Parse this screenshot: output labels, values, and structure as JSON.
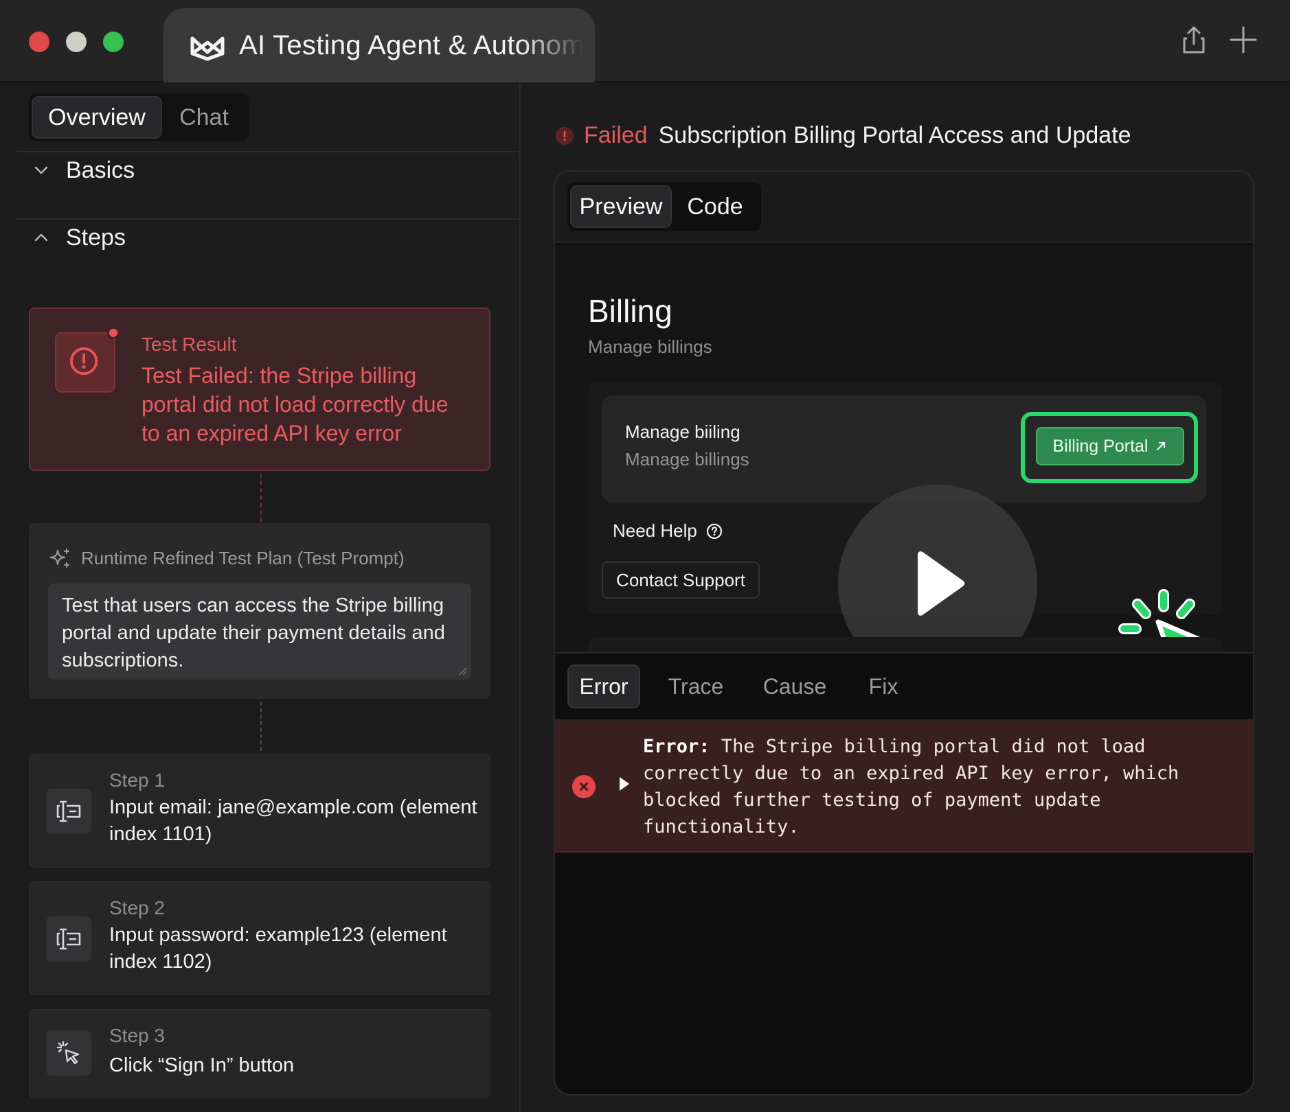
{
  "window": {
    "title": "AI Testing Agent & Autonomous Testing",
    "buttons": {
      "close": "close-dot",
      "minimize": "minimize-dot",
      "maximize": "maximize-dot"
    },
    "actions": [
      "share-icon",
      "plus-icon"
    ]
  },
  "left": {
    "tabs": [
      {
        "label": "Overview",
        "active": true
      },
      {
        "label": "Chat",
        "active": false
      }
    ],
    "sections": {
      "basics": "Basics",
      "steps": "Steps"
    },
    "result": {
      "label": "Test Result",
      "text": "Test Failed: the Stripe billing portal did not load correctly due to an expired API key error"
    },
    "plan": {
      "label": "Runtime Refined Test Plan (Test Prompt)",
      "text": "Test that users can access the Stripe billing portal and update their payment details and subscriptions."
    },
    "steps": [
      {
        "number": "Step 1",
        "text": "Input email: jane@example.com (element index 1101)",
        "icon": "text-input-icon"
      },
      {
        "number": "Step 2",
        "text": "Input password: example123 (element index 1102)",
        "icon": "text-input-icon"
      },
      {
        "number": "Step 3",
        "text": "Click “Sign In” button",
        "icon": "click-icon"
      }
    ]
  },
  "right": {
    "status": "Failed",
    "title": "Subscription Billing Portal Access and Update",
    "viewTabs": [
      {
        "label": "Preview",
        "active": true
      },
      {
        "label": "Code",
        "active": false
      }
    ],
    "preview": {
      "title": "Billing",
      "subtitle": "Manage billings",
      "card_title": "Manage biiling",
      "card_subtitle": "Manage billings",
      "portal_button": "Billing Portal",
      "help": "Need Help",
      "contact": "Contact Support"
    },
    "detailTabs": [
      {
        "label": "Error",
        "active": true
      },
      {
        "label": "Trace",
        "active": false
      },
      {
        "label": "Cause",
        "active": false
      },
      {
        "label": "Fix",
        "active": false
      }
    ],
    "error": {
      "prefix": "Error:",
      "message": "The Stripe billing portal did not load correctly due to an expired API key error, which blocked further testing of payment update functionality."
    }
  },
  "colors": {
    "failure": "#e25a5d",
    "accent_green": "#27d86b",
    "background": "#1c1c1d"
  }
}
